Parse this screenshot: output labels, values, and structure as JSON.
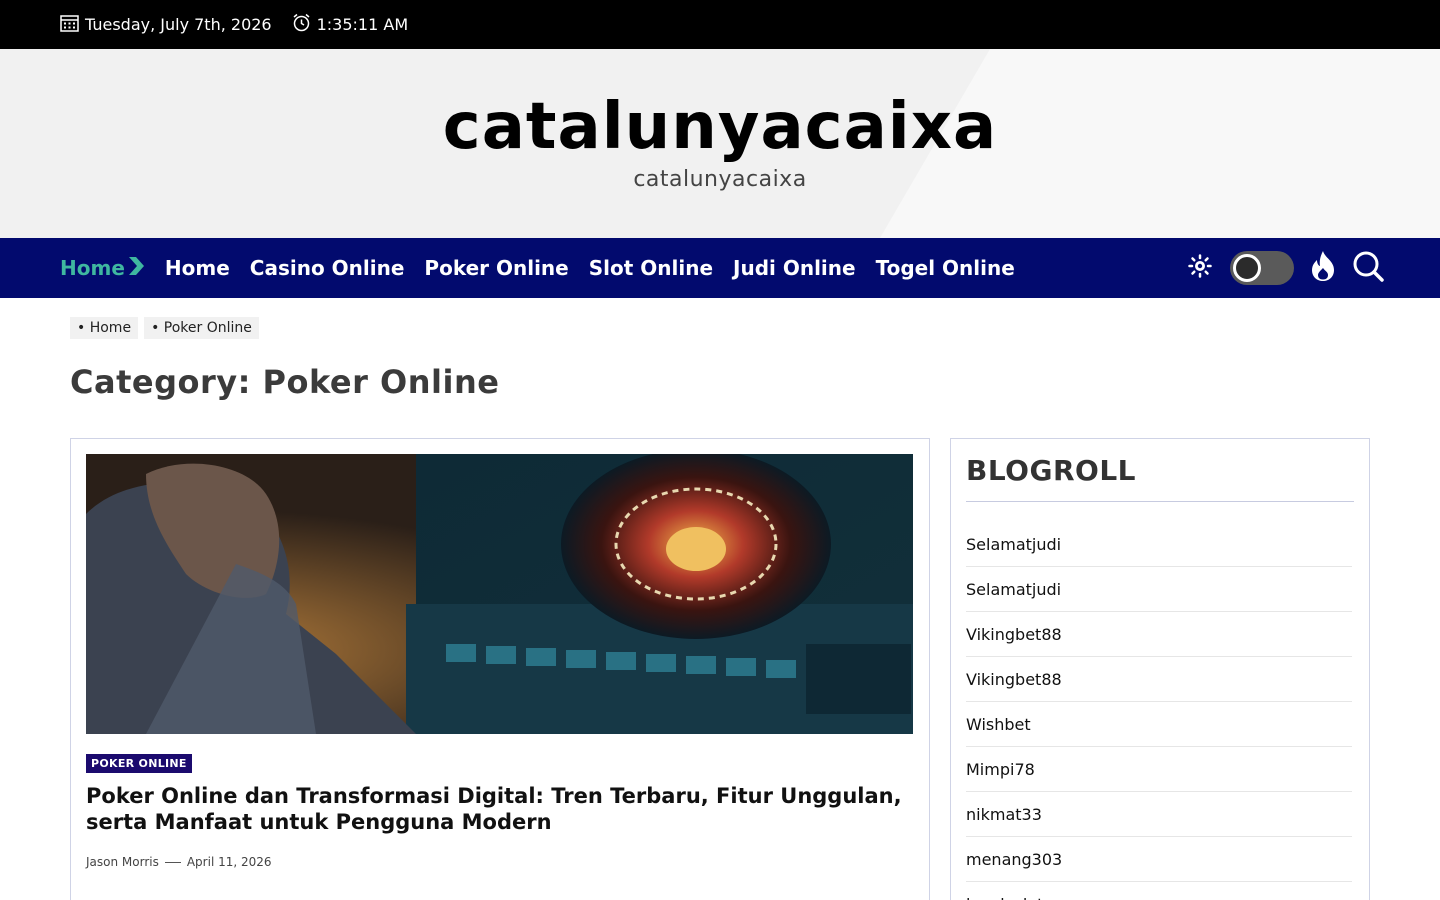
{
  "topbar": {
    "date": "Tuesday, July 7th, 2026",
    "time": "1:35:11 AM"
  },
  "header": {
    "site_title": "catalunyacaixa",
    "tagline": "catalunyacaixa"
  },
  "nav": {
    "items": [
      {
        "label": "Home"
      },
      {
        "label": "Home"
      },
      {
        "label": "Casino Online"
      },
      {
        "label": "Poker Online"
      },
      {
        "label": "Slot Online"
      },
      {
        "label": "Judi Online"
      },
      {
        "label": "Togel Online"
      }
    ]
  },
  "breadcrumb": [
    "• Home",
    "• Poker Online"
  ],
  "page_title": "Category: Poker Online",
  "post": {
    "category": "POKER ONLINE",
    "title": "Poker Online dan Transformasi Digital: Tren Terbaru, Fitur Unggulan, serta Manfaat untuk Pengguna Modern",
    "author": "Jason Morris",
    "date": "April 11, 2026"
  },
  "sidebar": {
    "title": "BLOGROLL",
    "links": [
      "Selamatjudi",
      "Selamatjudi",
      "Vikingbet88",
      "Vikingbet88",
      "Wishbet",
      "Mimpi78",
      "nikmat33",
      "menang303",
      "lapak slot"
    ]
  },
  "colors": {
    "nav_bg": "#020a6e",
    "active_nav": "#3fb7a0",
    "badge_bg": "#1b0a6e",
    "topbar_bg": "#000000"
  }
}
